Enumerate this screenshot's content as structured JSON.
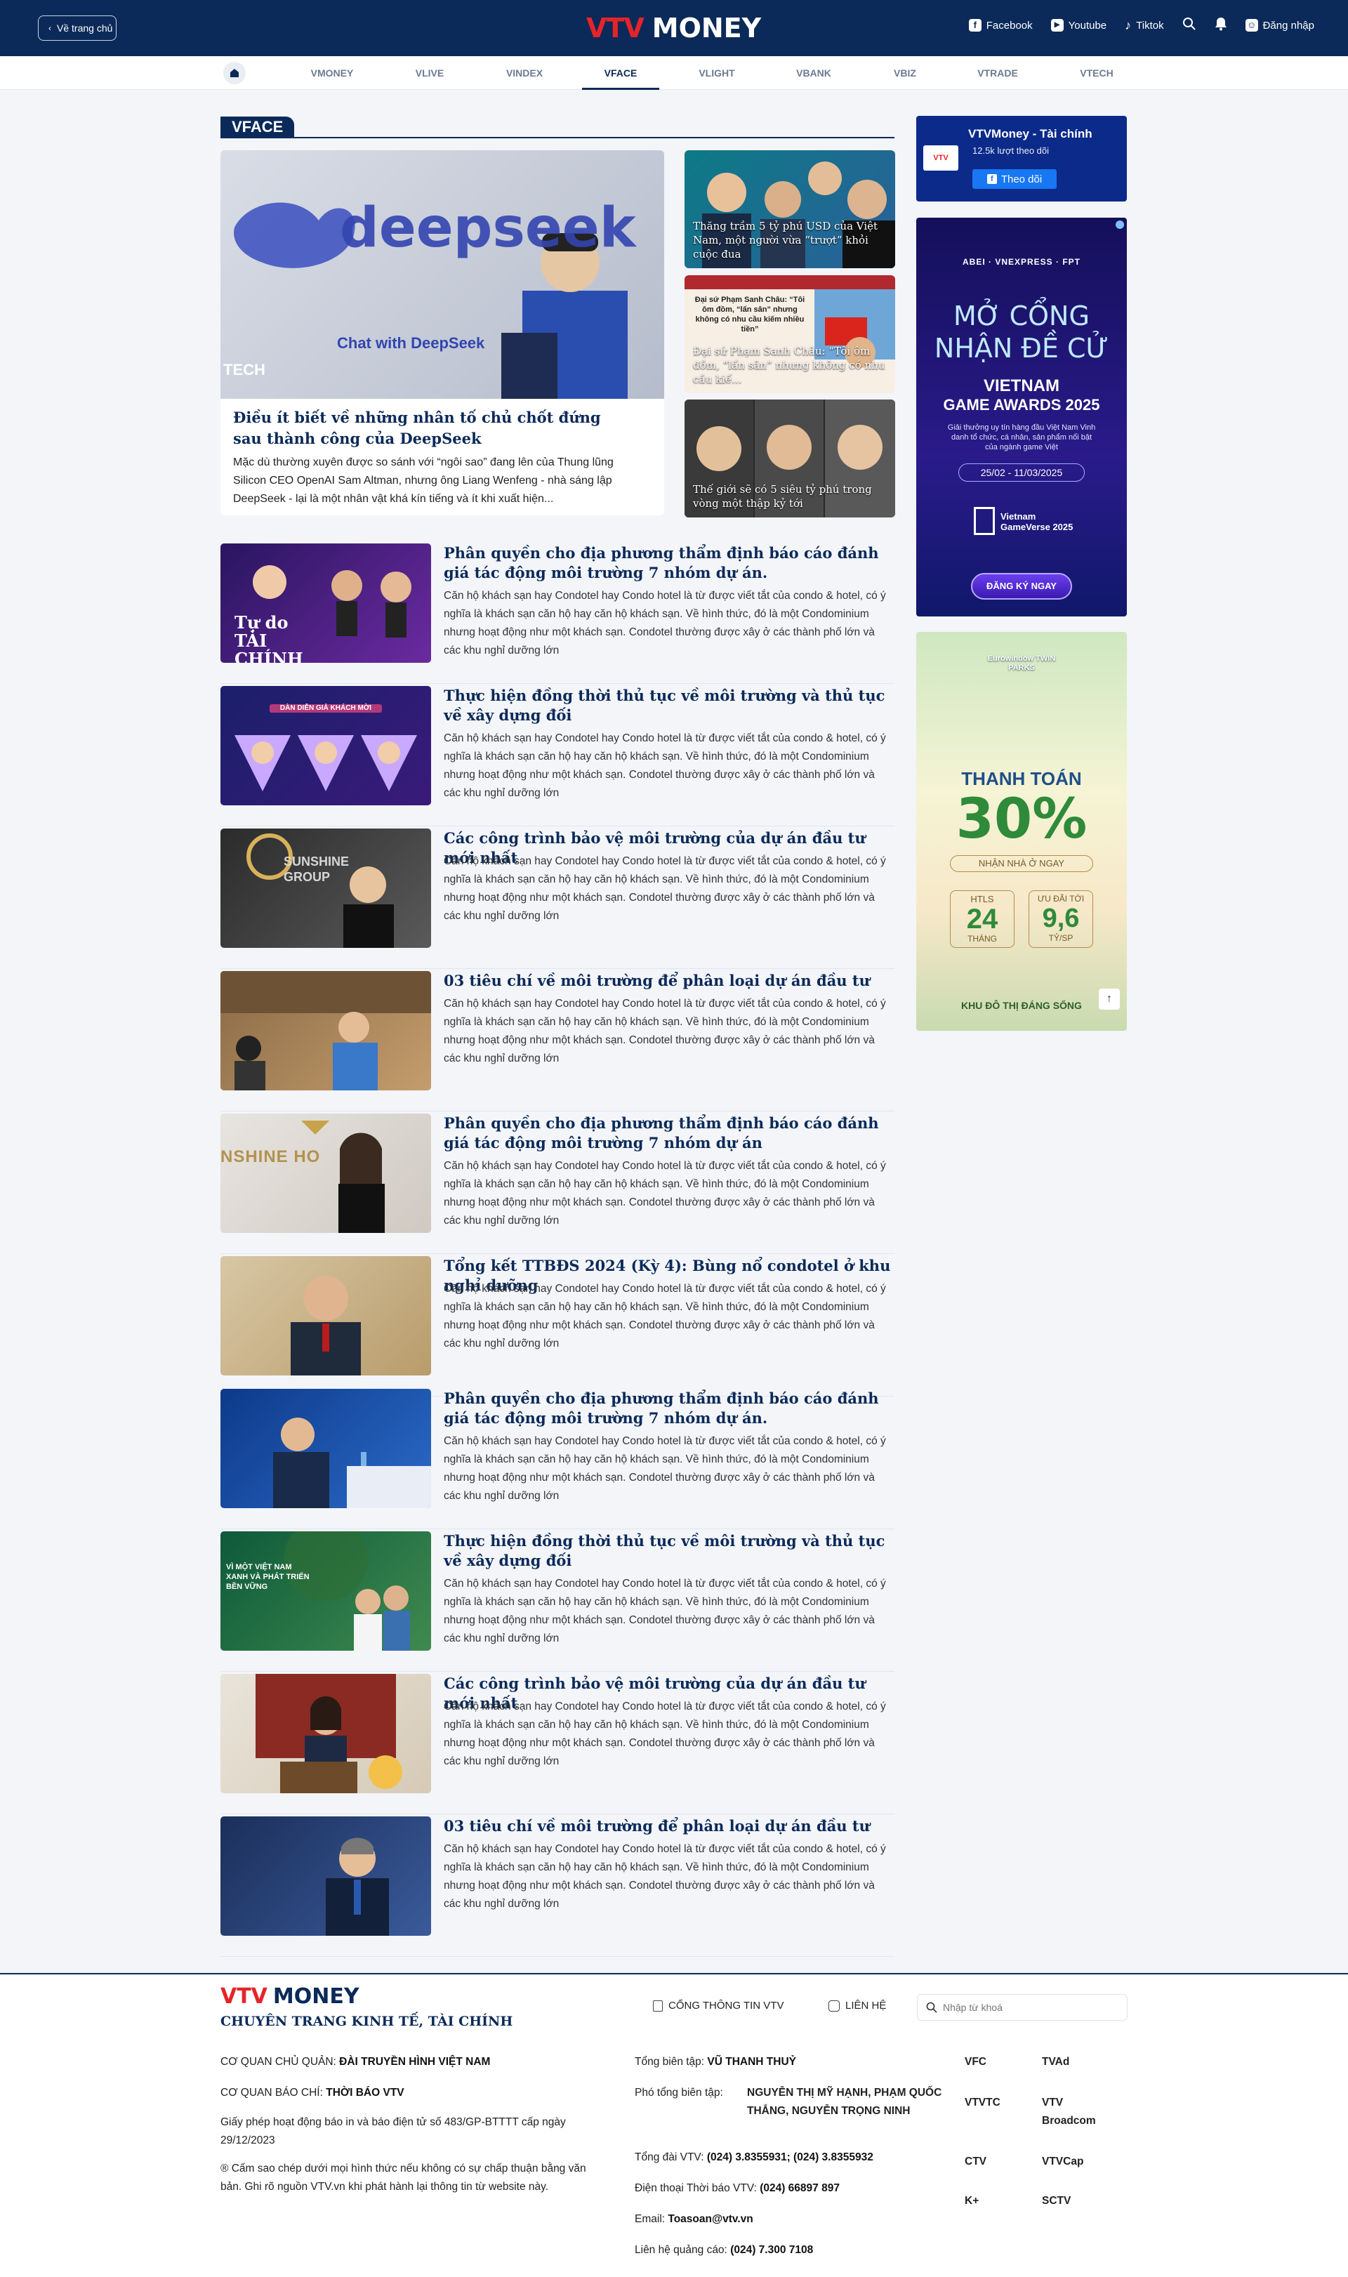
{
  "header": {
    "back_label": "Về trang chủ",
    "logo_vtv": "VTV",
    "logo_money": "MONEY",
    "facebook": "Facebook",
    "youtube": "Youtube",
    "tiktok": "Tiktok",
    "login": "Đăng nhập"
  },
  "nav": {
    "items": [
      "VMONEY",
      "VLIVE",
      "VINDEX",
      "VFACE",
      "VLIGHT",
      "VBANK",
      "VBIZ",
      "VTRADE",
      "VTECH"
    ],
    "active": "VFACE"
  },
  "section": {
    "title": "VFACE"
  },
  "featured": {
    "image_text_main": "deepseek",
    "image_text_sub": "Chat with DeepSeek",
    "image_text_tech": "TECH",
    "title": "Điều ít biết về những nhân tố chủ chốt đứng sau thành công của DeepSeek",
    "summary": "Mặc dù thường xuyên được so sánh với “ngôi sao” đang lên của Thung lũng Silicon CEO OpenAI Sam Altman, nhưng ông Liang Wenfeng - nhà sáng lập DeepSeek - lại là một nhân vật khá kín tiếng và ít khi xuất hiện..."
  },
  "side_stories": [
    {
      "title": "Thăng trầm 5 tỷ phú USD của Việt Nam, một người vừa “trượt” khỏi cuộc đua"
    },
    {
      "title": "Đại sứ Phạm Sanh Châu: “Tôi ôm đồm, “lấn sân” nhưng không có nhu cầu kiế...",
      "inner_heading": "Đại sứ Phạm Sanh Châu: “Tôi ôm đồm, “lấn sân” nhưng không có nhu cầu kiếm nhiều tiền”"
    },
    {
      "title": "Thế giới sẽ có 5 siêu tỷ phú trong vòng một thập kỷ tới"
    }
  ],
  "articles": [
    {
      "title": "Phân quyền cho địa phương thẩm định báo cáo đánh giá tác động môi trường 7 nhóm dự án.",
      "summary": "Căn hộ khách sạn hay Condotel hay Condo hotel là từ được viết tắt của condo & hotel, có ý nghĩa là khách sạn căn hộ hay căn hộ khách sạn. Về hình thức, đó là một Condominium nhưng hoạt động như một khách sạn. Condotel thường được xây ở các thành phố lớn và các khu nghỉ dưỡng lớn",
      "thumb_text": "Tự do TÀI CHÍNH"
    },
    {
      "title": "Thực hiện đồng thời thủ tục về môi trường và thủ tục về xây dựng đối",
      "summary": "Căn hộ khách sạn hay Condotel hay Condo hotel là từ được viết tắt của condo & hotel, có ý nghĩa là khách sạn căn hộ hay căn hộ khách sạn. Về hình thức, đó là một Condominium nhưng hoạt động như một khách sạn. Condotel thường được xây ở các thành phố lớn và các khu nghỉ dưỡng lớn",
      "thumb_text": "DÀN DIỄN GIẢ KHÁCH MỜI"
    },
    {
      "title": "Các công trình bảo vệ môi trường của dự án đầu tư mới nhất",
      "summary": "Căn hộ khách sạn hay Condotel hay Condo hotel là từ được viết tắt của condo & hotel, có ý nghĩa là khách sạn căn hộ hay căn hộ khách sạn. Về hình thức, đó là một Condominium nhưng hoạt động như một khách sạn. Condotel thường được xây ở các thành phố lớn và các khu nghỉ dưỡng lớn",
      "thumb_text": "SUNSHINE GROUP"
    },
    {
      "title": "03 tiêu chí về môi trường để phân loại dự án đầu tư",
      "summary": "Căn hộ khách sạn hay Condotel hay Condo hotel là từ được viết tắt của condo & hotel, có ý nghĩa là khách sạn căn hộ hay căn hộ khách sạn. Về hình thức, đó là một Condominium nhưng hoạt động như một khách sạn. Condotel thường được xây ở các thành phố lớn và các khu nghỉ dưỡng lớn",
      "thumb_text": ""
    },
    {
      "title": "Phân quyền cho địa phương thẩm định báo cáo đánh giá tác động môi trường 7 nhóm dự án",
      "summary": "Căn hộ khách sạn hay Condotel hay Condo hotel là từ được viết tắt của condo & hotel, có ý nghĩa là khách sạn căn hộ hay căn hộ khách sạn. Về hình thức, đó là một Condominium nhưng hoạt động như một khách sạn. Condotel thường được xây ở các thành phố lớn và các khu nghỉ dưỡng lớn",
      "thumb_text": "NSHINE HO"
    },
    {
      "title": "Tổng kết TTBĐS 2024 (Kỳ 4): Bùng nổ condotel ở khu nghỉ dưỡng",
      "summary": "Căn hộ khách sạn hay Condotel hay Condo hotel là từ được viết tắt của condo & hotel, có ý nghĩa là khách sạn căn hộ hay căn hộ khách sạn. Về hình thức, đó là một Condominium nhưng hoạt động như một khách sạn. Condotel thường được xây ở các thành phố lớn và các khu nghỉ dưỡng lớn",
      "thumb_text": ""
    },
    {
      "title": "Phân quyền cho địa phương thẩm định báo cáo đánh giá tác động môi trường 7 nhóm dự án.",
      "summary": "Căn hộ khách sạn hay Condotel hay Condo hotel là từ được viết tắt của condo & hotel, có ý nghĩa là khách sạn căn hộ hay căn hộ khách sạn. Về hình thức, đó là một Condominium nhưng hoạt động như một khách sạn. Condotel thường được xây ở các thành phố lớn và các khu nghỉ dưỡng lớn",
      "thumb_text": ""
    },
    {
      "title": "Thực hiện đồng thời thủ tục về môi trường và thủ tục về xây dựng đối",
      "summary": "Căn hộ khách sạn hay Condotel hay Condo hotel là từ được viết tắt của condo & hotel, có ý nghĩa là khách sạn căn hộ hay căn hộ khách sạn. Về hình thức, đó là một Condominium nhưng hoạt động như một khách sạn. Condotel thường được xây ở các thành phố lớn và các khu nghỉ dưỡng lớn",
      "thumb_text": "VÌ MỘT VIỆT NAM XANH VÀ PHÁT TRIỂN BỀN VỮNG"
    },
    {
      "title": "Các công trình bảo vệ môi trường của dự án đầu tư mới nhất",
      "summary": "Căn hộ khách sạn hay Condotel hay Condo hotel là từ được viết tắt của condo & hotel, có ý nghĩa là khách sạn căn hộ hay căn hộ khách sạn. Về hình thức, đó là một Condominium nhưng hoạt động như một khách sạn. Condotel thường được xây ở các thành phố lớn và các khu nghỉ dưỡng lớn",
      "thumb_text": ""
    },
    {
      "title": "03 tiêu chí về môi trường để phân loại dự án đầu tư",
      "summary": "Căn hộ khách sạn hay Condotel hay Condo hotel là từ được viết tắt của condo & hotel, có ý nghĩa là khách sạn căn hộ hay căn hộ khách sạn. Về hình thức, đó là một Condominium nhưng hoạt động như một khách sạn. Condotel thường được xây ở các thành phố lớn và các khu nghỉ dưỡng lớn",
      "thumb_text": ""
    }
  ],
  "ads": {
    "fanpage": {
      "name": "VTVMoney - Tài chính",
      "followers": "12.5k lượt theo dõi",
      "button": "Theo dõi"
    },
    "game_awards": {
      "logos": "ABEI · VNEXPRESS · FPT",
      "headline1": "MỞ CỔNG",
      "headline2": "NHẬN ĐỀ CỬ",
      "brand1": "VIETNAM",
      "brand2": "GAME AWARDS 2025",
      "desc": "Giải thưởng uy tín hàng đầu Việt Nam Vinh danh tổ chức, cá nhân, sản phẩm nổi bật của ngành game Việt",
      "dates": "25/02 - 11/03/2025",
      "gameverse": "Vietnam GameVerse 2025",
      "cta": "ĐĂNG KÝ NGAY"
    },
    "eurowindow": {
      "brand": "Eurowindow TWIN PARKS",
      "pay": "THANH TOÁN",
      "percent": "30%",
      "sub": "NHẬN NHÀ Ở NGAY",
      "htls_label": "HTLS",
      "htls_value": "24",
      "htls_unit": "THÁNG",
      "udt_label": "ƯU ĐÃI TỚI",
      "udt_value": "9,6",
      "udt_unit": "TỶ/SP",
      "footer": "KHU ĐÔ THỊ ĐÁNG SỐNG"
    }
  },
  "footer": {
    "logo_vtv": "VTV",
    "logo_money": "MONEY",
    "tagline": "CHUYÊN TRANG KINH TẾ, TÀI CHÍNH",
    "link_portal": "CỔNG THÔNG TIN VTV",
    "link_contact": "LIÊN HỆ",
    "search_placeholder": "Nhập từ khoá",
    "governing_label": "CƠ QUAN CHỦ QUẢN:",
    "governing_value": "ĐÀI TRUYỀN HÌNH VIỆT NAM",
    "press_label": "CƠ QUAN BÁO CHÍ:",
    "press_value": "THỜI BÁO VTV",
    "license": "Giấy phép hoạt động báo in và báo điện tử số 483/GP-BTTTT cấp ngày 29/12/2023",
    "copyright": "® Cấm sao chép dưới mọi hình thức nếu không có sự chấp thuận bằng văn bản. Ghi rõ nguồn VTV.vn khi phát hành lại thông tin từ website này.",
    "editor_label": "Tổng biên tập:",
    "editor_value": "VŨ THANH THUỶ",
    "deputy_label": "Phó tổng biên tập:",
    "deputy_value": "NGUYỄN THỊ MỸ HẠNH, PHẠM QUỐC THẮNG, NGUYỄN TRỌNG NINH",
    "switchboard_label": "Tổng đài VTV:",
    "switchboard_value": "(024) 3.8355931; (024) 3.8355932",
    "phone_label": "Điện thoại Thời báo VTV:",
    "phone_value": "(024) 66897 897",
    "email_label": "Email:",
    "email_value": "Toasoan@vtv.vn",
    "ads_label": "Liên hệ quảng cáo:",
    "ads_value": "(024) 7.300 7108",
    "partners": [
      "VFC",
      "TVAd",
      "VTVTC",
      "VTV Broadcom",
      "CTV",
      "VTVCap",
      "K+",
      "SCTV"
    ]
  }
}
